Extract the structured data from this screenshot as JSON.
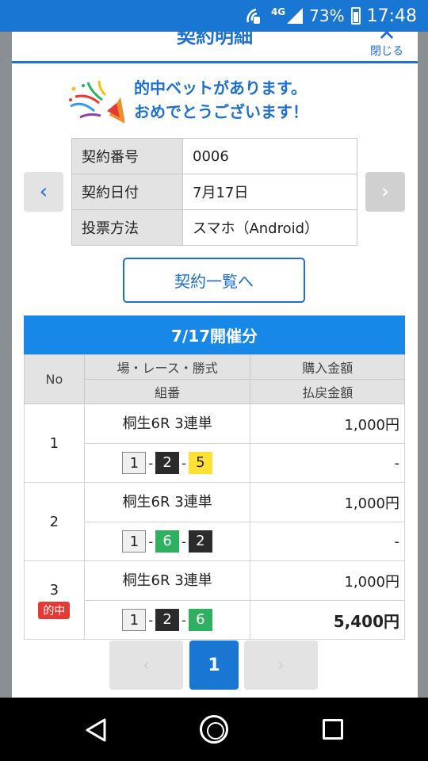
{
  "status_bar": {
    "network": "4G",
    "battery": "73%",
    "time": "17:48"
  },
  "modal": {
    "title": "契約明細",
    "close_label": "閉じる",
    "hit_message": [
      "的中ベットがあります。",
      "おめでとうございます！"
    ],
    "contract": [
      {
        "label": "契約番号",
        "value": "0006"
      },
      {
        "label": "契約日付",
        "value": "7月17日"
      },
      {
        "label": "投票方法",
        "value": "スマホ（Android）"
      }
    ],
    "list_button": "契約一覧へ",
    "date_header": "7/17開催分",
    "columns": {
      "no": "No",
      "race": "場・レース・勝式",
      "combo": "組番",
      "purchase": "購入金額",
      "payout": "払戻金額"
    },
    "bets": [
      {
        "no": "1",
        "race": "桐生6R 3連単",
        "combo": [
          "1",
          "2",
          "5"
        ],
        "purchase": "1,000円",
        "payout": "-",
        "hit": false
      },
      {
        "no": "2",
        "race": "桐生6R 3連単",
        "combo": [
          "1",
          "6",
          "2"
        ],
        "purchase": "1,000円",
        "payout": "-",
        "hit": false
      },
      {
        "no": "3",
        "race": "桐生6R 3連単",
        "combo": [
          "1",
          "2",
          "6"
        ],
        "purchase": "1,000円",
        "payout": "5,400円",
        "hit": true,
        "hit_label": "的中"
      }
    ],
    "combo_dash": "-",
    "pager": {
      "prev": "‹",
      "current": "1",
      "next": "›"
    },
    "nav_prev": "‹",
    "nav_next": "›"
  },
  "colors": {
    "accent": "#1976d2",
    "hit_badge": "#e53935",
    "boat1": "#f0f0f0",
    "boat2": "#2b2b2b",
    "boat5": "#ffe135",
    "boat6": "#2eb060"
  },
  "icons": [
    "wifi-call-icon",
    "signal-icon",
    "battery-icon",
    "close-icon",
    "party-popper-icon",
    "chevron-left-icon",
    "chevron-right-icon",
    "back-icon",
    "home-icon",
    "recents-icon"
  ]
}
